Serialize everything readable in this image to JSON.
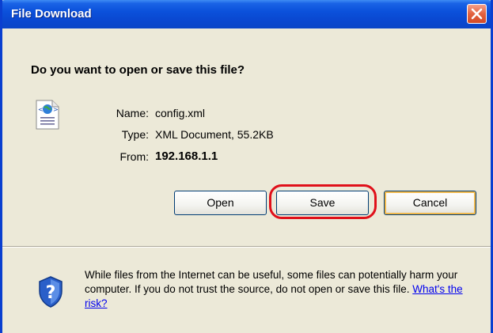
{
  "window": {
    "title": "File Download"
  },
  "prompt": {
    "question": "Do you want to open or save this file?"
  },
  "file": {
    "icon": "xml-document-icon",
    "name_label": "Name:",
    "name_value": "config.xml",
    "type_label": "Type:",
    "type_value": "XML Document, 55.2KB",
    "from_label": "From:",
    "from_value": "192.168.1.1"
  },
  "buttons": {
    "open": "Open",
    "save": "Save",
    "cancel": "Cancel"
  },
  "warning": {
    "icon": "security-shield-icon",
    "text": "While files from the Internet can be useful, some files can potentially harm your computer. If you do not trust the source, do not open or save this file. ",
    "link": "What's the risk?"
  },
  "colors": {
    "titlebar": "#0a48d1",
    "dialog_bg": "#ece9d8",
    "highlight": "#e0101a",
    "link": "#0000ee"
  }
}
